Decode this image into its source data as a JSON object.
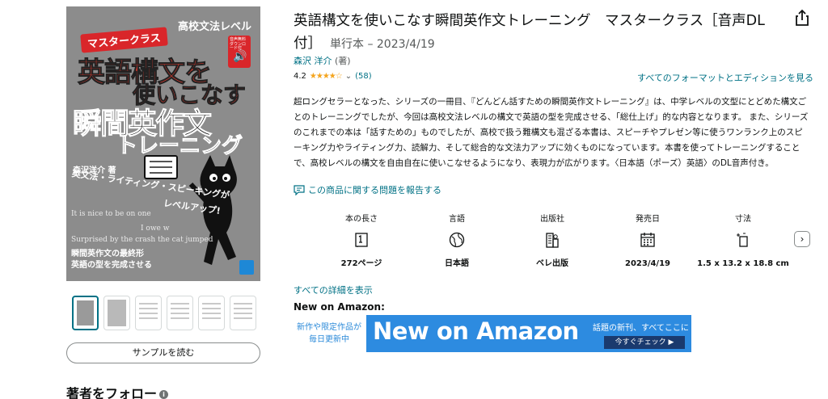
{
  "cover": {
    "level": "高校文法レベル",
    "master": "マスタークラス",
    "audio_note": "音声無料ダウンロード付",
    "title_line1": "英語構文を",
    "title_line2": "使いこなす",
    "title_line3": "瞬間英作文",
    "title_line4": "トレーニング",
    "author": "森沢洋介 著",
    "tagline": "英文法・ライティング・スピーキングが",
    "levelup": "レベルアップ!",
    "example1": "It is nice to be on one",
    "example2": "I owe w",
    "example3": "Surprised by the crash the cat jumped",
    "bottom1": "瞬間英作文の最終形",
    "bottom2": "英語の型を完成させる"
  },
  "thumbnails": {
    "count": 6
  },
  "sample_button": "サンプルを読む",
  "follow_author": "著者をフォロー",
  "product": {
    "title": "英語構文を使いこなす瞬間英作文トレーニング　マスタークラス［音声DL付］",
    "binding": "単行本 – 2023/4/19",
    "author": "森沢 洋介",
    "author_role": "(著)",
    "rating": "4.2",
    "rating_stars": 4.2,
    "rating_count": "(58)",
    "formats_link": "すべてのフォーマットとエディションを見る",
    "description": "超ロングセラーとなった、シリーズの一冊目、『どんどん話すための瞬間英作文トレーニング』は、中学レベルの文型にとどめた構文ごとのトレーニングでしたが、今回は高校文法レベルの構文で英語の型を完成させる、「総仕上げ」的な内容となります。 また、シリーズのこれまでの本は「話すための」ものでしたが、高校で扱う難構文も混ざる本書は、スピーチやプレゼン等に使うワンランク上のスピーキング力やライティング力、読解力、そして総合的な文法力アップに効くものになっています。本書を使ってトレーニングすることで、高校レベルの構文を自由自在に使いこなせるようになり、表現力が広がります。〈日本語（ポーズ）英語〉のDL音声付き。",
    "report_issue": "この商品に関する問題を報告する"
  },
  "details": [
    {
      "label": "本の長さ",
      "icon": "book-pages-icon",
      "value": "272ページ"
    },
    {
      "label": "言語",
      "icon": "globe-icon",
      "value": "日本語"
    },
    {
      "label": "出版社",
      "icon": "building-icon",
      "value": "ベレ出版"
    },
    {
      "label": "発売日",
      "icon": "calendar-icon",
      "value": "2023/4/19"
    },
    {
      "label": "寸法",
      "icon": "dimensions-icon",
      "value": "1.5 x 13.2 x 18.8 cm"
    }
  ],
  "all_details_link": "すべての詳細を表示",
  "new_on_amazon": {
    "label": "New on Amazon:",
    "left_text": "新作や限定作品が毎日更新中",
    "headline": "New on Amazon",
    "subtext": "話題の新刊、すべてここに",
    "cta": "今すぐチェック ▶"
  },
  "colors": {
    "link": "#007185",
    "star": "#f4a41d",
    "banner_blue": "#2d8be0",
    "banner_dark": "#1a3a6e"
  }
}
